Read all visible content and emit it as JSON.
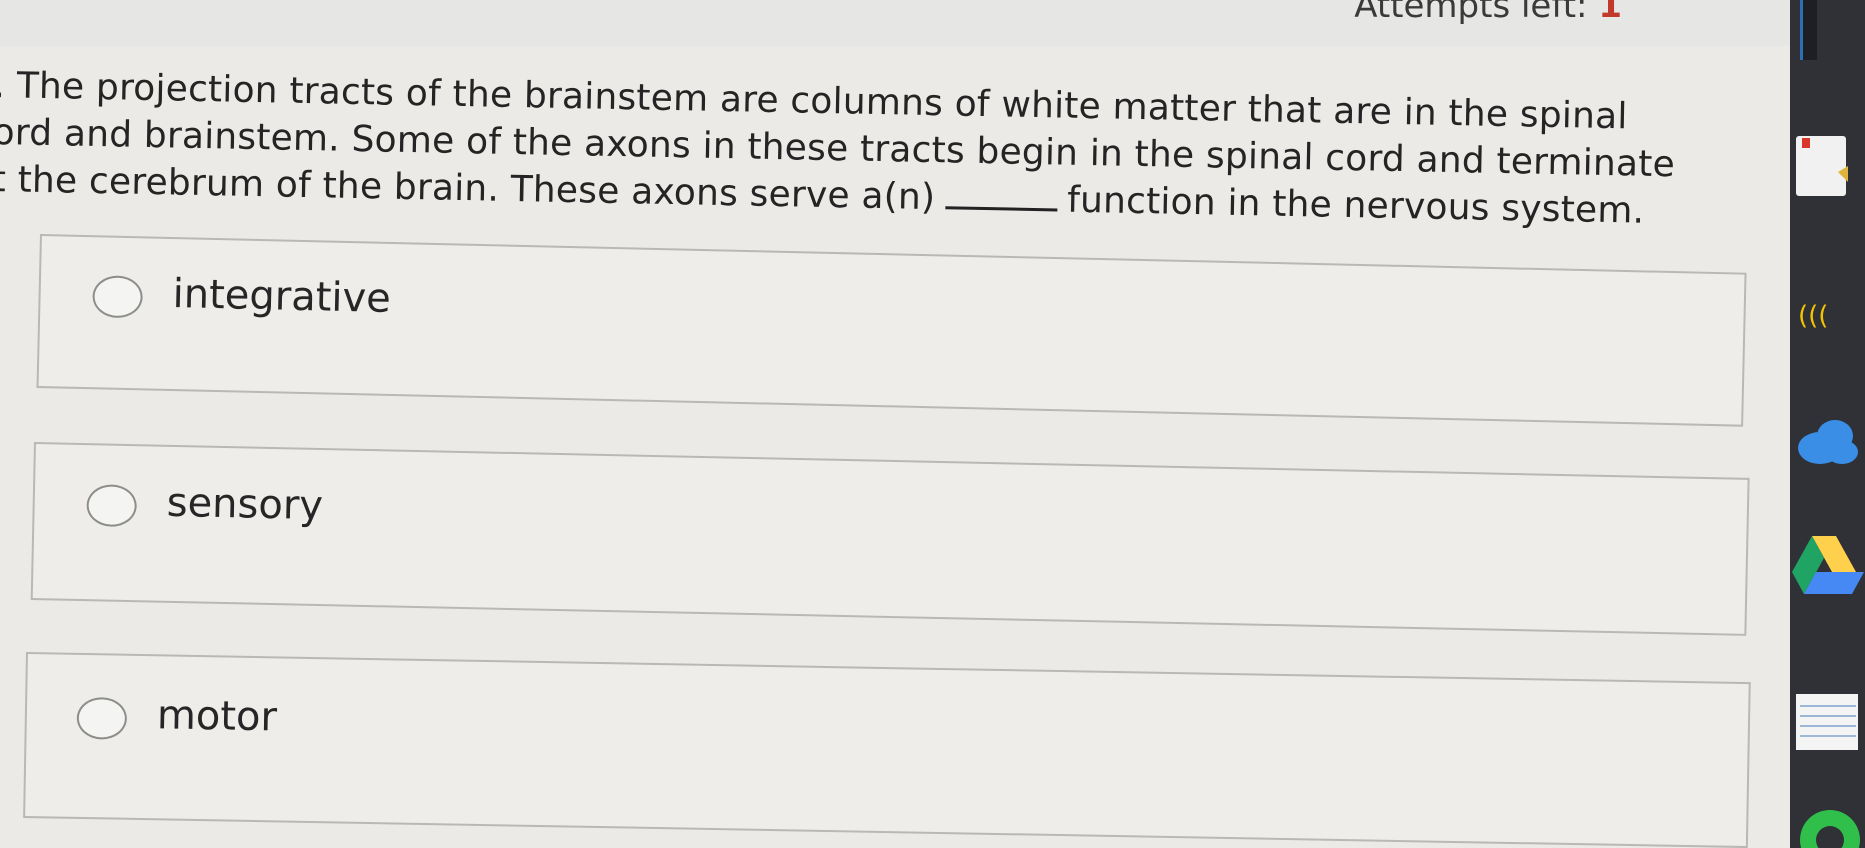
{
  "header": {
    "attempts_label": "Attempts left:",
    "attempts_count": "1"
  },
  "question": {
    "line1": ". The projection tracts of the brainstem are columns of white matter that are in the spinal",
    "line2": "ord and brainstem. Some of the axons in these tracts begin in the spinal cord and terminate",
    "line3_before_blank": "t the cerebrum of the brain. These axons serve a(n)",
    "line3_after_blank": "function in the nervous system."
  },
  "options": [
    {
      "label": "integrative"
    },
    {
      "label": "sensory"
    },
    {
      "label": "motor"
    }
  ],
  "dock": {
    "icons": [
      "doc-icon",
      "wifi-icon",
      "cloud-icon",
      "drive-icon",
      "notes-icon",
      "app-icon"
    ],
    "colors": {
      "cloud": "#3a8ee6",
      "drive_green": "#1fa463",
      "drive_yellow": "#ffd04b",
      "drive_blue": "#4688f4",
      "wifi": "#f2c400"
    }
  }
}
